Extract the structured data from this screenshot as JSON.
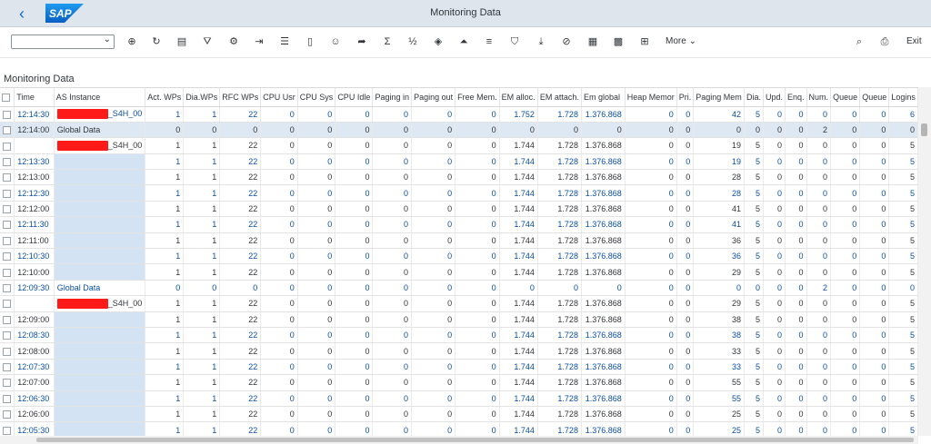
{
  "shell": {
    "logo_text": "SAP",
    "title": "Monitoring Data",
    "brand_color": "#0a6ed1"
  },
  "toolbar": {
    "layout_value": "",
    "icons": [
      "zoom-icon",
      "refresh-icon",
      "details-icon",
      "filter-settings-icon",
      "settings-icon",
      "export-icon",
      "list-icon",
      "mobile-icon",
      "user-icon",
      "send-icon",
      "sum-icon",
      "subtotal-icon",
      "chart-icon",
      "collapse-icon",
      "expand-icon",
      "filter-icon",
      "download-icon",
      "delete-filter-icon",
      "table-icon",
      "table-settings-icon",
      "table-layout-icon"
    ],
    "more_label": "More",
    "exit_label": "Exit"
  },
  "grid": {
    "title": "Monitoring Data",
    "columns": [
      "Time",
      "AS Instance",
      "Act. WPs",
      "Dia.WPs",
      "RFC WPs",
      "CPU Usr",
      "CPU Sys",
      "CPU Idle",
      "Paging in",
      "Paging out",
      "Free Mem.",
      "EM alloc.",
      "EM attach.",
      "Em global",
      "Heap Memor",
      "Pri.",
      "Paging Mem",
      "Dia.",
      "Upd.",
      "Enq.",
      "Num.",
      "Queue",
      "Queue",
      "Logins"
    ],
    "rows": [
      {
        "style": "alt",
        "time": "12:14:30",
        "inst": "_S4H_00",
        "redact": true,
        "v": [
          "1",
          "1",
          "22",
          "0",
          "0",
          "0",
          "0",
          "0",
          "0",
          "1.752",
          "1.728",
          "1.376.868",
          "0",
          "0",
          "42",
          "5",
          "0",
          "0",
          "0",
          "0",
          "0",
          "6"
        ]
      },
      {
        "style": "gd",
        "time": "12:14:00",
        "inst": "Global Data",
        "redact": false,
        "v": [
          "0",
          "0",
          "0",
          "0",
          "0",
          "0",
          "0",
          "0",
          "0",
          "0",
          "0",
          "0",
          "0",
          "0",
          "0",
          "0",
          "0",
          "0",
          "2",
          "0",
          "0",
          "0"
        ]
      },
      {
        "style": "norm",
        "time": "",
        "inst": "_S4H_00",
        "redact": true,
        "v": [
          "1",
          "1",
          "22",
          "0",
          "0",
          "0",
          "0",
          "0",
          "0",
          "1.744",
          "1.728",
          "1.376.868",
          "0",
          "0",
          "19",
          "5",
          "0",
          "0",
          "0",
          "0",
          "0",
          "5"
        ]
      },
      {
        "style": "alt hl",
        "time": "12:13:30",
        "inst": "",
        "redact": false,
        "v": [
          "1",
          "1",
          "22",
          "0",
          "0",
          "0",
          "0",
          "0",
          "0",
          "1.744",
          "1.728",
          "1.376.868",
          "0",
          "0",
          "19",
          "5",
          "0",
          "0",
          "0",
          "0",
          "0",
          "5"
        ]
      },
      {
        "style": "hl",
        "time": "12:13:00",
        "inst": "",
        "redact": false,
        "v": [
          "1",
          "1",
          "22",
          "0",
          "0",
          "0",
          "0",
          "0",
          "0",
          "1.744",
          "1.728",
          "1.376.868",
          "0",
          "0",
          "28",
          "5",
          "0",
          "0",
          "0",
          "0",
          "0",
          "5"
        ]
      },
      {
        "style": "alt hl",
        "time": "12:12:30",
        "inst": "",
        "redact": false,
        "v": [
          "1",
          "1",
          "22",
          "0",
          "0",
          "0",
          "0",
          "0",
          "0",
          "1.744",
          "1.728",
          "1.376.868",
          "0",
          "0",
          "28",
          "5",
          "0",
          "0",
          "0",
          "0",
          "0",
          "5"
        ]
      },
      {
        "style": "hl",
        "time": "12:12:00",
        "inst": "",
        "redact": false,
        "v": [
          "1",
          "1",
          "22",
          "0",
          "0",
          "0",
          "0",
          "0",
          "0",
          "1.744",
          "1.728",
          "1.376.868",
          "0",
          "0",
          "41",
          "5",
          "0",
          "0",
          "0",
          "0",
          "0",
          "5"
        ]
      },
      {
        "style": "alt hl",
        "time": "12:11:30",
        "inst": "",
        "redact": false,
        "v": [
          "1",
          "1",
          "22",
          "0",
          "0",
          "0",
          "0",
          "0",
          "0",
          "1.744",
          "1.728",
          "1.376.868",
          "0",
          "0",
          "41",
          "5",
          "0",
          "0",
          "0",
          "0",
          "0",
          "5"
        ]
      },
      {
        "style": "hl",
        "time": "12:11:00",
        "inst": "",
        "redact": false,
        "v": [
          "1",
          "1",
          "22",
          "0",
          "0",
          "0",
          "0",
          "0",
          "0",
          "1.744",
          "1.728",
          "1.376.868",
          "0",
          "0",
          "36",
          "5",
          "0",
          "0",
          "0",
          "0",
          "0",
          "5"
        ]
      },
      {
        "style": "alt hl",
        "time": "12:10:30",
        "inst": "",
        "redact": false,
        "v": [
          "1",
          "1",
          "22",
          "0",
          "0",
          "0",
          "0",
          "0",
          "0",
          "1.744",
          "1.728",
          "1.376.868",
          "0",
          "0",
          "36",
          "5",
          "0",
          "0",
          "0",
          "0",
          "0",
          "5"
        ]
      },
      {
        "style": "hl",
        "time": "12:10:00",
        "inst": "",
        "redact": false,
        "v": [
          "1",
          "1",
          "22",
          "0",
          "0",
          "0",
          "0",
          "0",
          "0",
          "1.744",
          "1.728",
          "1.376.868",
          "0",
          "0",
          "29",
          "5",
          "0",
          "0",
          "0",
          "0",
          "0",
          "5"
        ]
      },
      {
        "style": "alt",
        "time": "12:09:30",
        "inst": "Global Data",
        "redact": false,
        "v": [
          "0",
          "0",
          "0",
          "0",
          "0",
          "0",
          "0",
          "0",
          "0",
          "0",
          "0",
          "0",
          "0",
          "0",
          "0",
          "0",
          "0",
          "0",
          "2",
          "0",
          "0",
          "0"
        ]
      },
      {
        "style": "norm",
        "time": "",
        "inst": "_S4H_00",
        "redact": true,
        "v": [
          "1",
          "1",
          "22",
          "0",
          "0",
          "0",
          "0",
          "0",
          "0",
          "1.744",
          "1.728",
          "1.376.868",
          "0",
          "0",
          "29",
          "5",
          "0",
          "0",
          "0",
          "0",
          "0",
          "5"
        ]
      },
      {
        "style": "hl",
        "time": "12:09:00",
        "inst": "",
        "redact": false,
        "v": [
          "1",
          "1",
          "22",
          "0",
          "0",
          "0",
          "0",
          "0",
          "0",
          "1.744",
          "1.728",
          "1.376.868",
          "0",
          "0",
          "38",
          "5",
          "0",
          "0",
          "0",
          "0",
          "0",
          "5"
        ]
      },
      {
        "style": "alt hl",
        "time": "12:08:30",
        "inst": "",
        "redact": false,
        "v": [
          "1",
          "1",
          "22",
          "0",
          "0",
          "0",
          "0",
          "0",
          "0",
          "1.744",
          "1.728",
          "1.376.868",
          "0",
          "0",
          "38",
          "5",
          "0",
          "0",
          "0",
          "0",
          "0",
          "5"
        ]
      },
      {
        "style": "hl",
        "time": "12:08:00",
        "inst": "",
        "redact": false,
        "v": [
          "1",
          "1",
          "22",
          "0",
          "0",
          "0",
          "0",
          "0",
          "0",
          "1.744",
          "1.728",
          "1.376.868",
          "0",
          "0",
          "33",
          "5",
          "0",
          "0",
          "0",
          "0",
          "0",
          "5"
        ]
      },
      {
        "style": "alt hl",
        "time": "12:07:30",
        "inst": "",
        "redact": false,
        "v": [
          "1",
          "1",
          "22",
          "0",
          "0",
          "0",
          "0",
          "0",
          "0",
          "1.744",
          "1.728",
          "1.376.868",
          "0",
          "0",
          "33",
          "5",
          "0",
          "0",
          "0",
          "0",
          "0",
          "5"
        ]
      },
      {
        "style": "hl",
        "time": "12:07:00",
        "inst": "",
        "redact": false,
        "v": [
          "1",
          "1",
          "22",
          "0",
          "0",
          "0",
          "0",
          "0",
          "0",
          "1.744",
          "1.728",
          "1.376.868",
          "0",
          "0",
          "55",
          "5",
          "0",
          "0",
          "0",
          "0",
          "0",
          "5"
        ]
      },
      {
        "style": "alt hl",
        "time": "12:06:30",
        "inst": "",
        "redact": false,
        "v": [
          "1",
          "1",
          "22",
          "0",
          "0",
          "0",
          "0",
          "0",
          "0",
          "1.744",
          "1.728",
          "1.376.868",
          "0",
          "0",
          "55",
          "5",
          "0",
          "0",
          "0",
          "0",
          "0",
          "5"
        ]
      },
      {
        "style": "hl",
        "time": "12:06:00",
        "inst": "",
        "redact": false,
        "v": [
          "1",
          "1",
          "22",
          "0",
          "0",
          "0",
          "0",
          "0",
          "0",
          "1.744",
          "1.728",
          "1.376.868",
          "0",
          "0",
          "25",
          "5",
          "0",
          "0",
          "0",
          "0",
          "0",
          "5"
        ]
      },
      {
        "style": "alt hl",
        "time": "12:05:30",
        "inst": "",
        "redact": false,
        "v": [
          "1",
          "1",
          "22",
          "0",
          "0",
          "0",
          "0",
          "0",
          "0",
          "1.744",
          "1.728",
          "1.376.868",
          "0",
          "0",
          "25",
          "5",
          "0",
          "0",
          "0",
          "0",
          "0",
          "5"
        ]
      }
    ]
  }
}
